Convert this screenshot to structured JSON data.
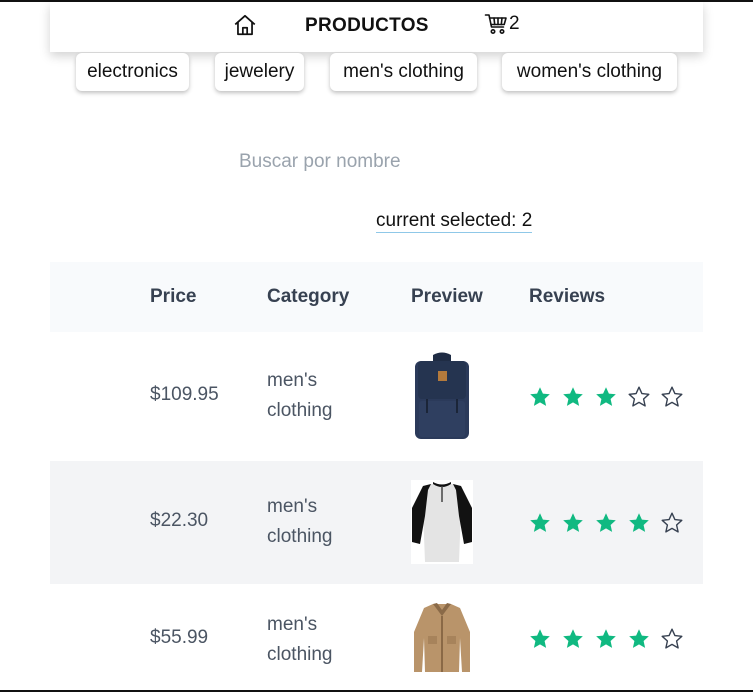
{
  "nav": {
    "title": "PRODUCTOS",
    "cart_count": "2",
    "home_icon": "home-icon",
    "cart_icon": "cart-icon"
  },
  "categories": [
    "electronics",
    "jewelery",
    "men's clothing",
    "women's clothing"
  ],
  "search": {
    "placeholder": "Buscar por nombre",
    "value": ""
  },
  "selection": {
    "label": "current selected: 2"
  },
  "table": {
    "headers": [
      "Price",
      "Category",
      "Preview",
      "Reviews"
    ],
    "rows": [
      {
        "price": "$109.95",
        "category": "men's clothing",
        "image": "backpack",
        "rating": 3,
        "max_rating": 5
      },
      {
        "price": "$22.30",
        "category": "men's clothing",
        "image": "raglan-shirt",
        "rating": 4,
        "max_rating": 5
      },
      {
        "price": "$55.99",
        "category": "men's clothing",
        "image": "jacket",
        "rating": 4,
        "max_rating": 5
      }
    ]
  },
  "colors": {
    "star_filled": "#10b981",
    "star_empty": "#374151",
    "header_bg": "#f8fafc",
    "alt_row_bg": "#f3f4f6"
  }
}
